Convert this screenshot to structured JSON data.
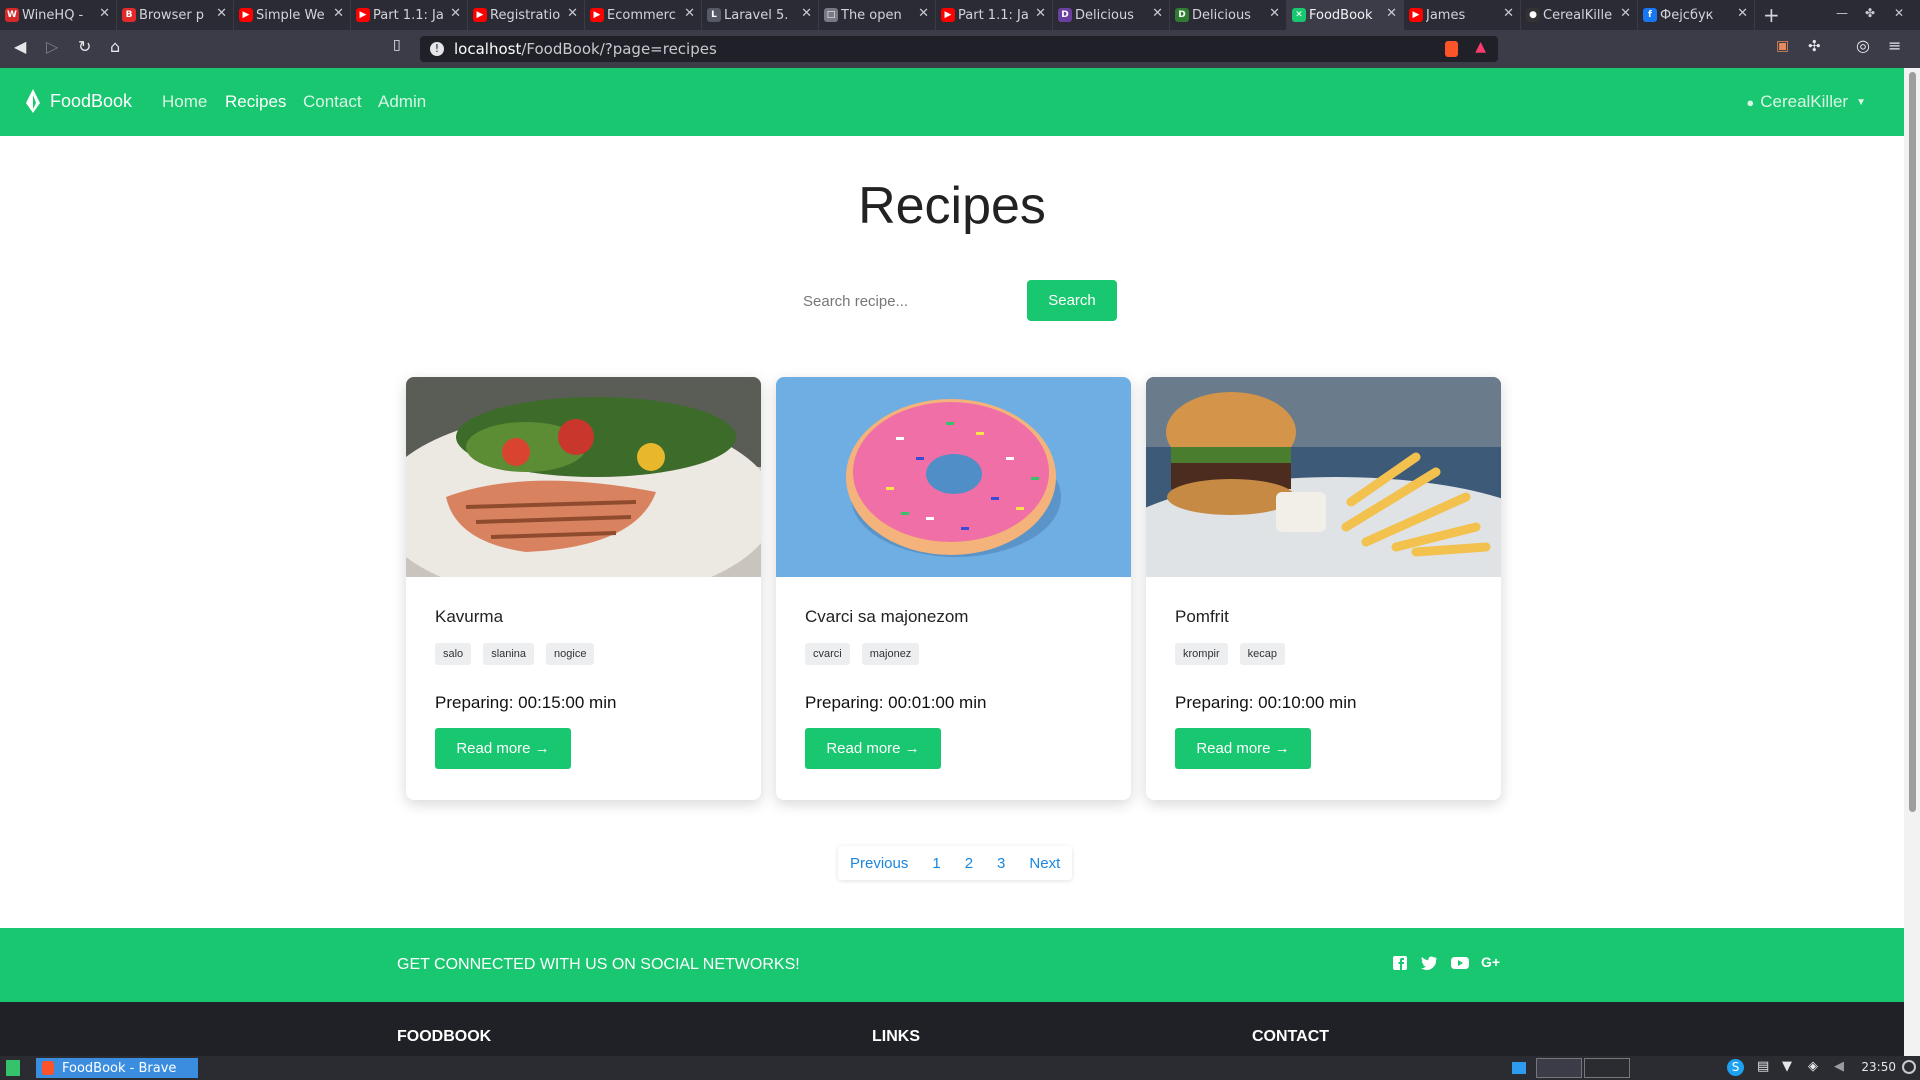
{
  "browser": {
    "tabs": [
      {
        "title": "WineHQ -",
        "color": "#d42a2a",
        "glyph": "W"
      },
      {
        "title": "Browser p",
        "color": "#e22a2a",
        "glyph": "B"
      },
      {
        "title": "Simple We",
        "color": "#ff0000",
        "glyph": "▶"
      },
      {
        "title": "Part 1.1: Ja",
        "color": "#ff0000",
        "glyph": "▶"
      },
      {
        "title": "Registratio",
        "color": "#ff0000",
        "glyph": "▶"
      },
      {
        "title": "Ecommerc",
        "color": "#ff0000",
        "glyph": "▶"
      },
      {
        "title": "Laravel 5.",
        "color": "#555a66",
        "glyph": "L"
      },
      {
        "title": "The open",
        "color": "#777a84",
        "glyph": "□"
      },
      {
        "title": "Part 1.1: Ja",
        "color": "#ff0000",
        "glyph": "▶"
      },
      {
        "title": "Delicious",
        "color": "#6b3fa0",
        "glyph": "D"
      },
      {
        "title": "Delicious",
        "color": "#2e7d32",
        "glyph": "D"
      },
      {
        "title": "FoodBook",
        "color": "#18c76f",
        "glyph": "✕",
        "active": true
      },
      {
        "title": "James",
        "color": "#ff0000",
        "glyph": "▶"
      },
      {
        "title": "CerealKille",
        "color": "#333333",
        "glyph": "●"
      },
      {
        "title": "Фејсбук",
        "color": "#1877f2",
        "glyph": "f"
      }
    ],
    "url_host": "localhost",
    "url_path": "/FoodBook/?page=recipes"
  },
  "nav": {
    "brand": "FoodBook",
    "links": [
      "Home",
      "Recipes",
      "Contact",
      "Admin"
    ],
    "active": "Recipes",
    "user": "CerealKiller"
  },
  "page": {
    "title": "Recipes",
    "search_placeholder": "Search recipe...",
    "search_button": "Search"
  },
  "recipes": [
    {
      "name": "Kavurma",
      "tags": [
        "salo",
        "slanina",
        "nogice"
      ],
      "preparing": "Preparing: 00:15:00 min",
      "button": "Read more →",
      "image": "grilled-salmon-salad"
    },
    {
      "name": "Cvarci sa majonezom",
      "tags": [
        "cvarci",
        "majonez"
      ],
      "preparing": "Preparing: 00:01:00 min",
      "button": "Read more →",
      "image": "pink-sprinkled-donut"
    },
    {
      "name": "Pomfrit",
      "tags": [
        "krompir",
        "kecap"
      ],
      "preparing": "Preparing: 00:10:00 min",
      "button": "Read more →",
      "image": "burger-and-fries"
    }
  ],
  "pagination": [
    "Previous",
    "1",
    "2",
    "3",
    "Next"
  ],
  "footer": {
    "connect_text": "GET CONNECTED WITH US ON SOCIAL NETWORKS!",
    "social": [
      "facebook-icon",
      "twitter-icon",
      "youtube-icon",
      "google-plus-icon"
    ],
    "headings": [
      "FOODBOOK",
      "LINKS",
      "CONTACT"
    ]
  },
  "taskbar": {
    "window_title": "FoodBook - Brave",
    "clock": "23:50"
  },
  "colors": {
    "brand_green": "#18c76f",
    "link_blue": "#1a86e0",
    "footer_dark": "#1f2126"
  }
}
